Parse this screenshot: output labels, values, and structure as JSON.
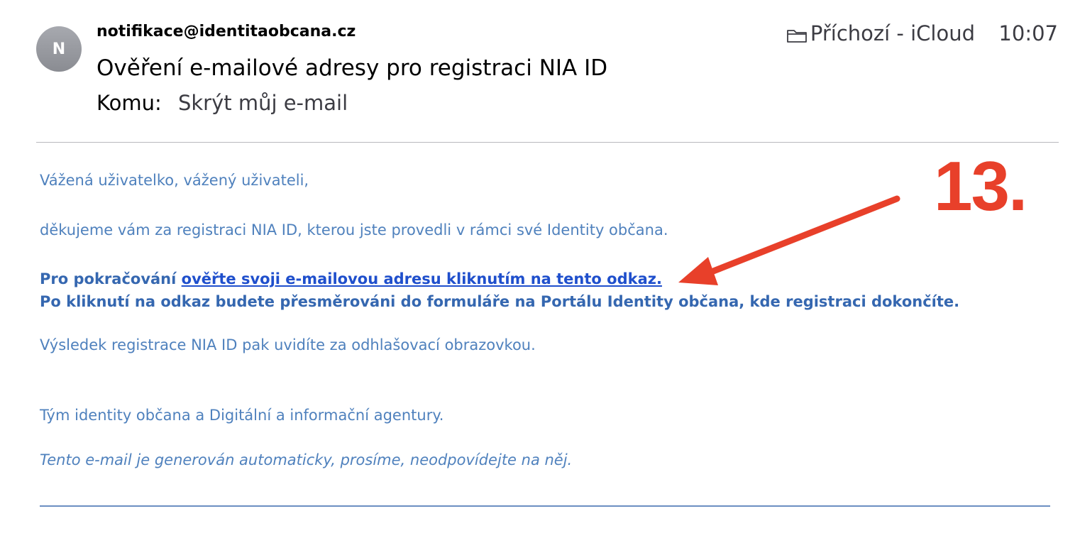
{
  "email": {
    "avatar_initial": "N",
    "sender": "notifikace@identitaobcana.cz",
    "subject": "Ověření e-mailové adresy pro registraci NIA ID",
    "to_label": "Komu:",
    "to_value": "Skrýt můj e-mail",
    "mailbox": "Příchozí - iCloud",
    "time": "10:07"
  },
  "body": {
    "greeting": "Vážená uživatelko, vážený uživateli,",
    "thanks": "děkujeme vám za registraci NIA ID, kterou jste provedli v rámci své Identity občana.",
    "continue_prefix": "Pro pokračování ",
    "verify_link": "ověřte svoji e-mailovou adresu kliknutím na tento odkaz.",
    "redirect_note": "Po kliknutí na odkaz budete přesměrováni do formuláře na Portálu Identity občana, kde registraci dokončíte.",
    "result_note": "Výsledek registrace NIA ID pak uvidíte za odhlašovací obrazovkou.",
    "signature": "Tým identity občana a Digitální a informační agentury.",
    "auto_note": "Tento e-mail je generován automaticky, prosíme, neodpovídejte na něj."
  },
  "annotation": {
    "step": "13.",
    "color": "#e8402a"
  },
  "colors": {
    "body_text": "#4f81bd",
    "link": "#1f4fcc"
  }
}
